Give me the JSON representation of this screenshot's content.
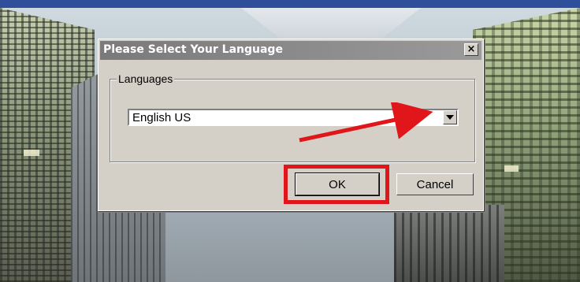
{
  "dialog": {
    "title": "Please Select Your Language",
    "close_label": "×",
    "group_label": "Languages",
    "language_select": {
      "value": "English US"
    },
    "ok_label": "OK",
    "cancel_label": "Cancel"
  },
  "annotations": {
    "highlight_color": "#e0161a",
    "arrow_color": "#e0161a"
  }
}
